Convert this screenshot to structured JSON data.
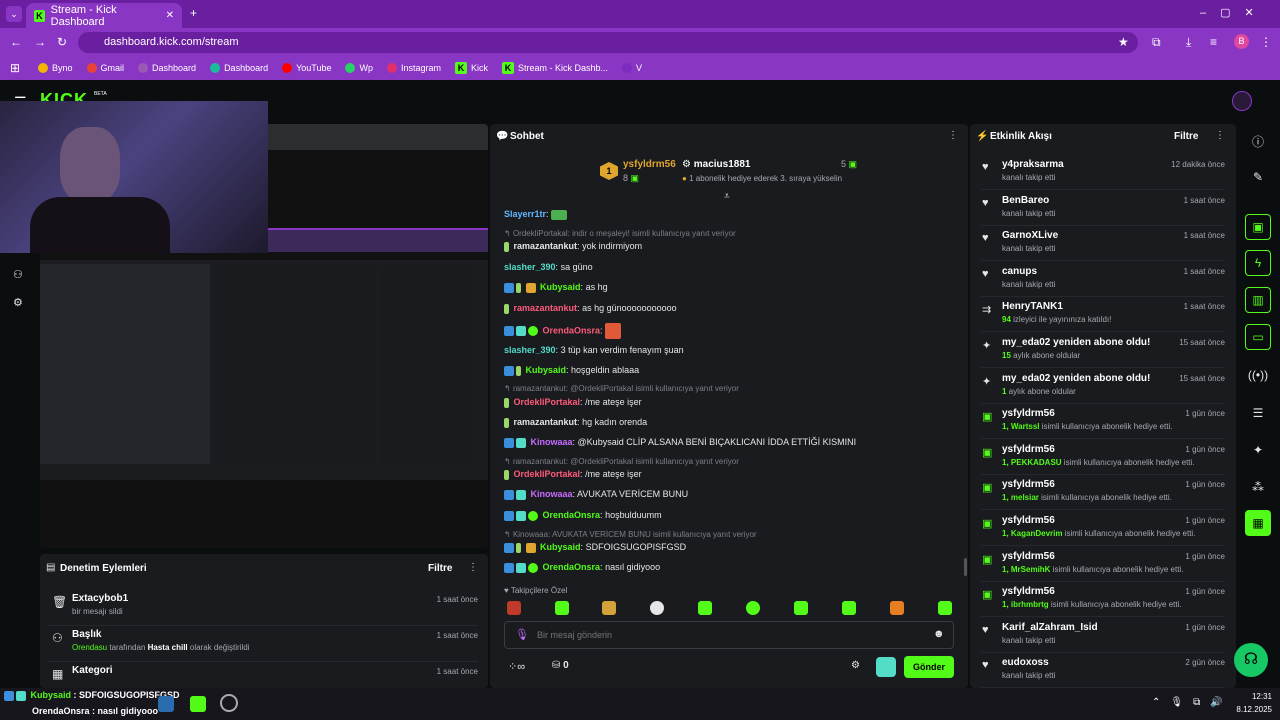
{
  "browser": {
    "tab_title": "Stream - Kick Dashboard",
    "url": "dashboard.kick.com/stream",
    "bookmarks": [
      "Byno",
      "Gmail",
      "Dashboard",
      "Dashboard",
      "YouTube",
      "Wp",
      "Instagram",
      "Kick",
      "Stream - Kick Dashb...",
      "V"
    ],
    "profile_initial": "B"
  },
  "app": {
    "beta": "BETA"
  },
  "chat": {
    "title": "Sohbet",
    "leaderboard": {
      "rank": "1",
      "first_user": "ysfyldrm56",
      "first_count": "8",
      "second_user": "macius1881",
      "second_count": "5",
      "hint": "1 abonelik hediye ederek 3. sıraya yükselin"
    },
    "followers_only": "Takipçilere Özel",
    "placeholder": "Bir mesaj gönderin",
    "count": "0",
    "send": "Gönder",
    "messages": [
      {
        "user": "Slayerr1tr",
        "color": "#5fb7ff",
        "text": ""
      },
      {
        "reply": "OrdekliPortakal: indir o meşaleyi! isimli kullanıcıya yanıt veriyor"
      },
      {
        "user": "ramazantankut",
        "color": "#e6e6e6",
        "text": "yok indirmiyom"
      },
      {
        "user": "slasher_390",
        "color": "#53dcc8",
        "text": "sa güno"
      },
      {
        "user": "Kubysaid",
        "color": "#53fc18",
        "text": "as hg"
      },
      {
        "user": "ramazantankut",
        "color": "#e6e6e6",
        "text": "as hg günooooooooooo"
      },
      {
        "user": "OrendaOnsra",
        "color": "#ff5a7a",
        "text": ""
      },
      {
        "user": "slasher_390",
        "color": "#53dcc8",
        "text": "3 tüp kan verdim fenayım şuan"
      },
      {
        "user": "Kubysaid",
        "color": "#53fc18",
        "text": "hoşgeldin ablaaa"
      },
      {
        "reply": "ramazantankut: @OrdekliPortakal isimli kullanıcıya yanıt veriyor"
      },
      {
        "user": "OrdekliPortakal",
        "color": "#ff5a7a",
        "text": "/me ateşe işer"
      },
      {
        "user": "ramazantankut",
        "color": "#e6e6e6",
        "text": "hg kadın orenda"
      },
      {
        "user": "Kinowaaa",
        "color": "#c86bff",
        "text": "@Kubysaid CLİP ALSANA BENİ BIÇAKLICANI İDDA ETTİĞİ KISMINI"
      },
      {
        "reply": "ramazantankut: @OrdekliPortakal isimli kullanıcıya yanıt veriyor"
      },
      {
        "user": "OrdekliPortakal",
        "color": "#ff5a7a",
        "text": "/me ateşe işer"
      },
      {
        "user": "Kinowaaa",
        "color": "#c86bff",
        "text": "AVUKATA VERİCEM BUNU"
      },
      {
        "user": "OrendaOnsra",
        "color": "#ff5a7a",
        "text": "hoşbulduumm"
      },
      {
        "reply": "Kinowaaa: AVUKATA VERİCEM BUNU isimli kullanıcıya yanıt veriyor"
      },
      {
        "user": "Kubysaid",
        "color": "#53fc18",
        "text": "SDFOIGSUGOPISFGSD"
      },
      {
        "user": "OrendaOnsra",
        "color": "#ff5a7a",
        "text": "nasıl gidiyooo"
      }
    ]
  },
  "activity": {
    "title": "Etkinlik Akışı",
    "filter": "Filtre",
    "items": [
      {
        "icon": "heart",
        "name": "y4praksarma",
        "desc": "kanalı takip etti",
        "time": "12 dakika önce"
      },
      {
        "icon": "heart",
        "name": "BenBareo",
        "desc": "kanalı takip etti",
        "time": "1 saat önce"
      },
      {
        "icon": "heart",
        "name": "GarnoXLive",
        "desc": "kanalı takip etti",
        "time": "1 saat önce"
      },
      {
        "icon": "heart",
        "name": "canups",
        "desc": "kanalı takip etti",
        "time": "1 saat önce"
      },
      {
        "icon": "raid",
        "name": "HenryTANK1",
        "desc_hl": "94",
        "desc": " izleyici ile yayınınıza katıldı!",
        "time": "1 saat önce"
      },
      {
        "icon": "sparkle",
        "name": "my_eda02 yeniden abone oldu!",
        "desc_hl": "15",
        "desc": " aylık abone oldular",
        "time": "15 saat önce"
      },
      {
        "icon": "sparkle",
        "name": "my_eda02 yeniden abone oldu!",
        "desc_hl": "1",
        "desc": " aylık abone oldular",
        "time": "15 saat önce"
      },
      {
        "icon": "gift",
        "name": "ysfyldrm56",
        "desc_hl": "1, Wartssl",
        "desc": " isimli kullanıcıya abonelik hediye etti.",
        "time": "1 gün önce"
      },
      {
        "icon": "gift",
        "name": "ysfyldrm56",
        "desc_hl": "1, PEKKADASU",
        "desc": " isimli kullanıcıya abonelik hediye etti.",
        "time": "1 gün önce"
      },
      {
        "icon": "gift",
        "name": "ysfyldrm56",
        "desc_hl": "1, melsiar",
        "desc": " isimli kullanıcıya abonelik hediye etti.",
        "time": "1 gün önce"
      },
      {
        "icon": "gift",
        "name": "ysfyldrm56",
        "desc_hl": "1, KaganDevrim",
        "desc": " isimli kullanıcıya abonelik hediye etti.",
        "time": "1 gün önce"
      },
      {
        "icon": "gift",
        "name": "ysfyldrm56",
        "desc_hl": "1, MrSemihK",
        "desc": " isimli kullanıcıya abonelik hediye etti.",
        "time": "1 gün önce"
      },
      {
        "icon": "gift",
        "name": "ysfyldrm56",
        "desc_hl": "1, ibrhmbrtg",
        "desc": " isimli kullanıcıya abonelik hediye etti.",
        "time": "1 gün önce"
      },
      {
        "icon": "heart",
        "name": "Karif_alZahram_Isid",
        "desc": "kanalı takip etti",
        "time": "1 gün önce"
      },
      {
        "icon": "heart",
        "name": "eudoxoss",
        "desc": "kanalı takip etti",
        "time": "2 gün önce"
      }
    ]
  },
  "moderation": {
    "title": "Denetim Eylemleri",
    "filter": "Filtre",
    "rows": [
      {
        "icon": "trash",
        "name": "Extacybob1",
        "desc": "bir mesajı sildi",
        "time": "1 saat önce"
      },
      {
        "icon": "users",
        "name": "Başlık",
        "desc_user": "Orendasu",
        "desc_mid": " tarafından ",
        "desc_val": "Hasta chill",
        "desc_end": " olarak değiştirildi",
        "time": "1 saat önce"
      },
      {
        "icon": "list",
        "name": "Kategori",
        "desc": "",
        "time": "1 saat önce"
      }
    ]
  },
  "taskbar": {
    "overlay1_user": "Kubysaid",
    "overlay1_text": " : SDFOIGSUGOPISFGSD",
    "overlay2_user": "OrendaOnsra",
    "overlay2_text": " : nasıl gidiyooo",
    "time": "12:31",
    "date": "8.12.2025"
  },
  "colors": {
    "accent": "#53fc18",
    "browser": "#8a36c4",
    "panel": "#191b1f",
    "bg": "#0b0e0f"
  }
}
